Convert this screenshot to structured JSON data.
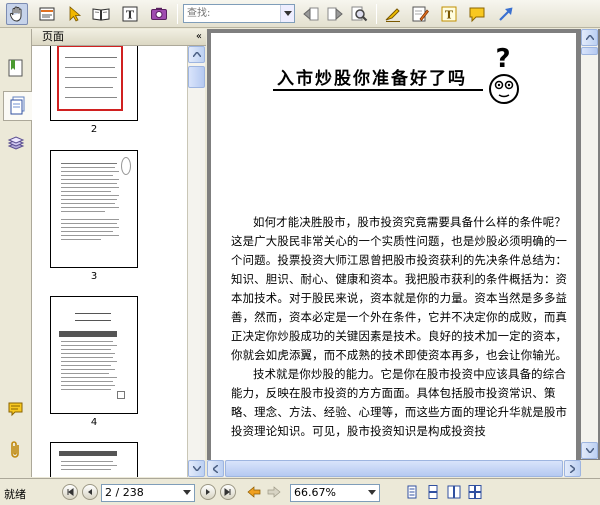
{
  "toolbar": {
    "search_placeholder": "查找:",
    "tools": [
      "hand-tool",
      "select-text-tool",
      "arrow-select-tool",
      "reading-tool",
      "text-select-tool",
      "snapshot-tool"
    ],
    "nav_tools": [
      "previous-result",
      "next-result",
      "find-search"
    ],
    "annot_tools": [
      "highlight-tool",
      "note-edit-tool",
      "text-box-tool",
      "comment-tool",
      "arrow-tool"
    ]
  },
  "panel": {
    "title": "页面",
    "collapse_icon": "«",
    "thumbnails": [
      {
        "label": "2"
      },
      {
        "label": "3"
      },
      {
        "label": "4"
      },
      {
        "label": ""
      }
    ]
  },
  "document": {
    "title": "入市炒股你准备好了吗",
    "paragraphs": [
      "如何才能决胜股市，股市投资究竟需要具备什么样的条件呢？这是广大股民非常关心的一个实质性问题，也是炒股必须明确的一个问题。投票投资大师江恩曾把股市投资获利的先决条件总结为：知识、胆识、耐心、健康和资本。我把股市获利的条件概括为：资本加技术。对于股民来说，资本就是你的力量。资本当然是多多益善，然而，资本必定是一个外在条件，它并不决定你的成败，而真正决定你炒股成功的关键因素是技术。良好的技术加一定的资本，你就会如虎添翼，而不成熟的技术即使资本再多，也会让你输光。",
      "技术就是你炒股的能力。它是你在股市投资中应该具备的综合能力，反映在股市投资的方方面面。具体包括股市投资常识、策略、理念、方法、经验、心理等，而这些方面的理论升华就是股市投资理论知识。可见，股市投资知识是构成投资技"
    ]
  },
  "status": {
    "text": "就绪",
    "page_value": "2 / 238",
    "zoom_value": "66.67%"
  }
}
